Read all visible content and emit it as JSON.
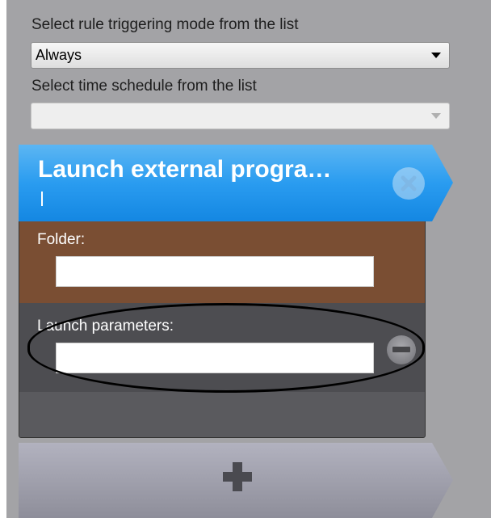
{
  "trigger_mode": {
    "label": "Select rule triggering mode from the list",
    "selected": "Always"
  },
  "schedule": {
    "label": "Select time schedule from the list",
    "selected": ""
  },
  "action_card": {
    "title": "Launch external progra…",
    "folder": {
      "label": "Folder:",
      "value": ""
    },
    "launch_parameters": {
      "label": "Launch parameters:",
      "value": ""
    }
  },
  "colors": {
    "panel_bg": "#a3a3a6",
    "header_blue": "#1e95e8",
    "folder_brown": "#7a4e33",
    "params_dark": "#4d4d51",
    "add_gray": "#9a9aa6"
  },
  "icons": {
    "close": "close-icon",
    "remove": "minus-icon",
    "add": "plus-icon",
    "dropdown": "chevron-down-icon"
  }
}
